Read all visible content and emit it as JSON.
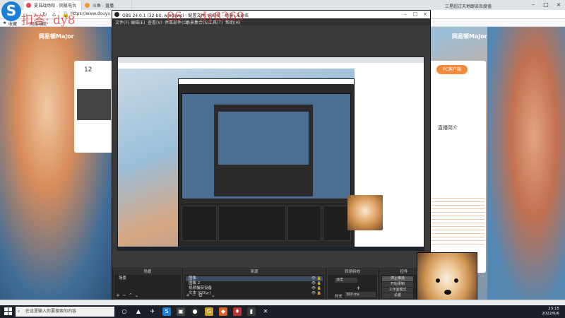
{
  "browser": {
    "logo": "S",
    "tabs": [
      {
        "label": "夏日战场和 - 网易电台"
      },
      {
        "label": "斗鱼 - 直播"
      }
    ],
    "right_tab": "三星超过天地跟谈及度值",
    "url": "https://www.douyu",
    "bookmarks": [
      "收藏",
      "网站导航"
    ],
    "site_banner": "网易顿Major",
    "site_banner_right": "网易顿Major",
    "card_number": "12",
    "pc_button": "PC客户端",
    "side_title": "直播简介"
  },
  "obs": {
    "title": "OBS 24.0.1 (32-bit, windows) - 配置文件: 未命名 - 场景: 未命名",
    "menu": [
      "文件(F)",
      "编辑(E)",
      "查看(V)",
      "停靠部件(D)",
      "场景集合(S)",
      "工具(T)",
      "帮助(H)"
    ],
    "docks": {
      "scenes": {
        "header": "场景",
        "items": [
          "场景"
        ]
      },
      "sources": {
        "header": "来源",
        "items": [
          "图像",
          "图像 2",
          "视频捕获设备",
          "文本 (GDI+)"
        ]
      },
      "transitions": {
        "header": "转场特效",
        "selected": "淡出",
        "duration_label": "时长",
        "duration_value": "300 ms"
      },
      "controls": {
        "header": "控件",
        "buttons": [
          "停止推流",
          "开始录制",
          "工作室模式",
          "设置",
          "退出"
        ]
      }
    }
  },
  "watermark": {
    "left": "扣答: dy8",
    "mid": "86",
    "right": "dy8369"
  },
  "taskbar": {
    "search_placeholder": "在这里输入你要搜索的内容",
    "time": "23:15",
    "date": "2022/6/6"
  }
}
